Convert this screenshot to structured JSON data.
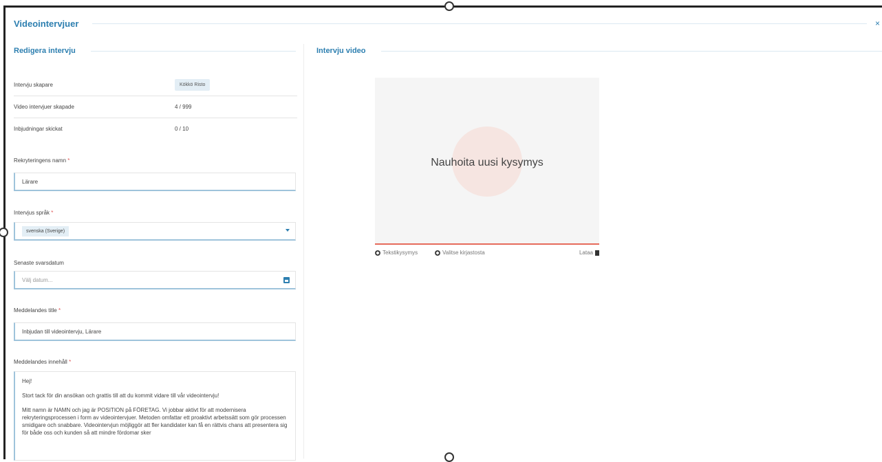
{
  "dialog": {
    "title": "Videointervjuer",
    "close": "×"
  },
  "left_section": {
    "title": "Redigera intervju"
  },
  "right_section": {
    "title": "Intervju video"
  },
  "info": [
    {
      "label": "Intervju skapare",
      "value": "Kökkö Risto"
    },
    {
      "label": "Video intervjuer skapade",
      "value": "4 / 999"
    },
    {
      "label": "Inbjudningar skickat",
      "value": "0 / 10"
    }
  ],
  "form": {
    "recruitment_name": {
      "label": "Rekryteringens namn",
      "required": "*",
      "value": "Lärare"
    },
    "language": {
      "label": "Intervjus språk",
      "required": "*",
      "value": "svenska (Sverige)"
    },
    "deadline": {
      "label": "Senaste svarsdatum",
      "placeholder": "Välj datum..."
    },
    "message_title": {
      "label": "Meddelandes title",
      "required": "*",
      "value": "Inbjudan till videointervju, Lärare"
    },
    "message_body": {
      "label": "Meddelandes innehåll",
      "required": "*",
      "paragraphs": [
        "Hej!",
        "Stort tack för din ansökan och grattis till att du kommit vidare till vår videointervju!",
        "Mitt namn är NAMN och jag är POSITION på FÖRETAG. Vi jobbar aktivt för att modernisera rekryteringsprocessen i form av videointervjuer. Metoden omfattar ett proaktivt arbetssätt som gör processen smidigare och snabbare. Videointervjun möjliggör att fler kandidater kan få en rättvis chans att presentera sig för både oss och kunden så att mindre fördomar sker"
      ]
    }
  },
  "video": {
    "prompt": "Nauhoita uusi kysymys",
    "text_question": "Tekstikysymys",
    "choose_library": "Valitse kirjastosta",
    "upload": "Lataa"
  }
}
